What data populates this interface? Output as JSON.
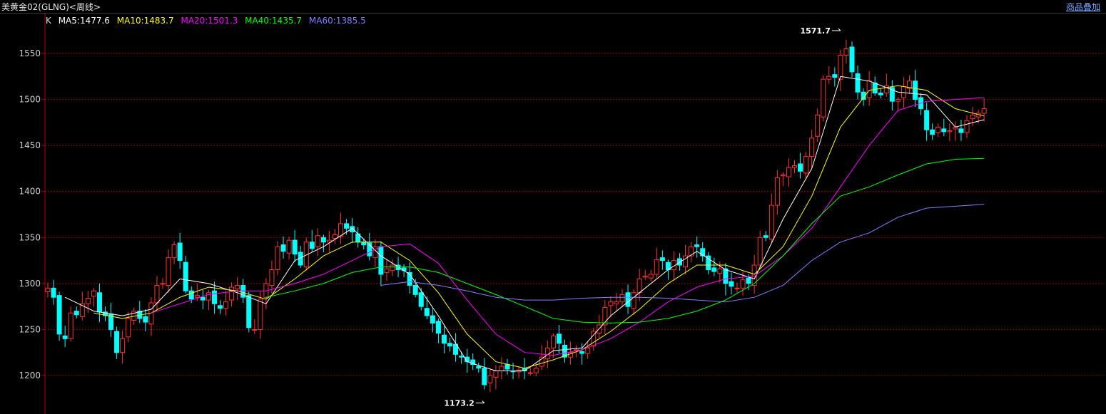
{
  "window": {
    "title": "美黄金02(GLNG)<周线>",
    "overlay_button": "商品叠加"
  },
  "legend": {
    "k_label": "K",
    "items": [
      {
        "text": "MA5:1477.6",
        "color": "#ffffff"
      },
      {
        "text": "MA10:1483.7",
        "color": "#ffff00"
      },
      {
        "text": "MA20:1501.3",
        "color": "#ff00ff"
      },
      {
        "text": "MA40:1435.7",
        "color": "#00ff00"
      },
      {
        "text": "MA60:1385.5",
        "color": "#8080ff"
      }
    ]
  },
  "colors": {
    "up": "#ff3232",
    "down": "#00ffff",
    "grid": "#8b0000",
    "axis_text": "#cccccc",
    "ma5": "#ffffff",
    "ma10": "#ffff00",
    "ma20": "#ff00ff",
    "ma40": "#00ff00",
    "ma60": "#8080ff"
  },
  "chart_data": {
    "type": "candlestick",
    "y_ticks": [
      1200,
      1250,
      1300,
      1350,
      1400,
      1450,
      1500,
      1550
    ],
    "ylim": [
      1173,
      1592
    ],
    "grid": true,
    "annotations": [
      {
        "text": "1571.7",
        "value": 1571.7,
        "index": 138,
        "kind": "high"
      },
      {
        "text": "1173.2",
        "value": 1173.2,
        "index": 76,
        "kind": "low"
      }
    ],
    "closes": [
      1295,
      1285,
      1245,
      1240,
      1268,
      1266,
      1278,
      1284,
      1292,
      1269,
      1265,
      1250,
      1225,
      1240,
      1262,
      1270,
      1262,
      1258,
      1279,
      1298,
      1300,
      1328,
      1342,
      1325,
      1292,
      1283,
      1287,
      1282,
      1290,
      1278,
      1273,
      1280,
      1296,
      1298,
      1285,
      1252,
      1250,
      1283,
      1300,
      1315,
      1340,
      1335,
      1347,
      1332,
      1320,
      1345,
      1338,
      1352,
      1345,
      1347,
      1353,
      1365,
      1360,
      1356,
      1345,
      1342,
      1330,
      1340,
      1310,
      1316,
      1320,
      1315,
      1314,
      1298,
      1288,
      1275,
      1265,
      1257,
      1246,
      1235,
      1232,
      1223,
      1220,
      1215,
      1212,
      1208,
      1190,
      1200,
      1205,
      1210,
      1207,
      1204,
      1206,
      1205,
      1203,
      1208,
      1220,
      1230,
      1243,
      1235,
      1220,
      1225,
      1228,
      1224,
      1230,
      1248,
      1255,
      1274,
      1280,
      1280,
      1288,
      1275,
      1290,
      1305,
      1308,
      1310,
      1326,
      1325,
      1315,
      1325,
      1320,
      1330,
      1340,
      1340,
      1330,
      1315,
      1313,
      1316,
      1300,
      1297,
      1295,
      1304,
      1300,
      1320,
      1350,
      1350,
      1385,
      1415,
      1418,
      1426,
      1428,
      1422,
      1438,
      1458,
      1483,
      1522,
      1525,
      1524,
      1548,
      1555,
      1530,
      1508,
      1500,
      1520,
      1507,
      1505,
      1515,
      1498,
      1500,
      1514,
      1520,
      1500,
      1490,
      1467,
      1462,
      1470,
      1465,
      1466,
      1470,
      1464,
      1477,
      1483,
      1485,
      1490
    ],
    "ma": [
      {
        "name": "MA5",
        "points": [
          [
            3,
            1285
          ],
          [
            8,
            1270
          ],
          [
            13,
            1265
          ],
          [
            18,
            1272
          ],
          [
            23,
            1305
          ],
          [
            28,
            1300
          ],
          [
            33,
            1290
          ],
          [
            38,
            1278
          ],
          [
            43,
            1325
          ],
          [
            48,
            1340
          ],
          [
            53,
            1360
          ],
          [
            58,
            1330
          ],
          [
            63,
            1310
          ],
          [
            68,
            1265
          ],
          [
            73,
            1215
          ],
          [
            78,
            1205
          ],
          [
            83,
            1205
          ],
          [
            88,
            1227
          ],
          [
            93,
            1230
          ],
          [
            98,
            1265
          ],
          [
            103,
            1290
          ],
          [
            108,
            1315
          ],
          [
            113,
            1335
          ],
          [
            118,
            1315
          ],
          [
            123,
            1305
          ],
          [
            128,
            1370
          ],
          [
            133,
            1425
          ],
          [
            138,
            1525
          ],
          [
            143,
            1520
          ],
          [
            148,
            1508
          ],
          [
            153,
            1505
          ],
          [
            158,
            1470
          ],
          [
            163,
            1478
          ]
        ]
      },
      {
        "name": "MA10",
        "points": [
          [
            8,
            1268
          ],
          [
            13,
            1262
          ],
          [
            18,
            1268
          ],
          [
            23,
            1285
          ],
          [
            28,
            1296
          ],
          [
            33,
            1292
          ],
          [
            38,
            1283
          ],
          [
            43,
            1305
          ],
          [
            48,
            1330
          ],
          [
            53,
            1345
          ],
          [
            58,
            1345
          ],
          [
            63,
            1325
          ],
          [
            68,
            1290
          ],
          [
            73,
            1245
          ],
          [
            78,
            1215
          ],
          [
            83,
            1208
          ],
          [
            88,
            1217
          ],
          [
            93,
            1228
          ],
          [
            98,
            1248
          ],
          [
            103,
            1272
          ],
          [
            108,
            1300
          ],
          [
            113,
            1320
          ],
          [
            118,
            1320
          ],
          [
            123,
            1310
          ],
          [
            128,
            1340
          ],
          [
            133,
            1395
          ],
          [
            138,
            1470
          ],
          [
            143,
            1510
          ],
          [
            148,
            1515
          ],
          [
            153,
            1510
          ],
          [
            158,
            1490
          ],
          [
            163,
            1482
          ]
        ]
      },
      {
        "name": "MA20",
        "points": [
          [
            18,
            1268
          ],
          [
            23,
            1278
          ],
          [
            28,
            1288
          ],
          [
            33,
            1292
          ],
          [
            38,
            1292
          ],
          [
            43,
            1300
          ],
          [
            48,
            1310
          ],
          [
            53,
            1325
          ],
          [
            58,
            1340
          ],
          [
            63,
            1343
          ],
          [
            68,
            1322
          ],
          [
            73,
            1282
          ],
          [
            78,
            1245
          ],
          [
            83,
            1225
          ],
          [
            88,
            1222
          ],
          [
            93,
            1228
          ],
          [
            98,
            1240
          ],
          [
            103,
            1258
          ],
          [
            108,
            1280
          ],
          [
            113,
            1296
          ],
          [
            118,
            1305
          ],
          [
            123,
            1308
          ],
          [
            128,
            1330
          ],
          [
            133,
            1360
          ],
          [
            138,
            1405
          ],
          [
            143,
            1450
          ],
          [
            148,
            1488
          ],
          [
            153,
            1498
          ],
          [
            158,
            1500
          ],
          [
            163,
            1502
          ]
        ]
      },
      {
        "name": "MA40",
        "points": [
          [
            38,
            1285
          ],
          [
            43,
            1292
          ],
          [
            48,
            1300
          ],
          [
            53,
            1312
          ],
          [
            58,
            1318
          ],
          [
            63,
            1318
          ],
          [
            68,
            1312
          ],
          [
            73,
            1300
          ],
          [
            78,
            1288
          ],
          [
            83,
            1275
          ],
          [
            88,
            1262
          ],
          [
            93,
            1258
          ],
          [
            98,
            1257
          ],
          [
            103,
            1258
          ],
          [
            108,
            1262
          ],
          [
            113,
            1270
          ],
          [
            118,
            1282
          ],
          [
            123,
            1300
          ],
          [
            128,
            1330
          ],
          [
            133,
            1365
          ],
          [
            138,
            1395
          ],
          [
            143,
            1405
          ],
          [
            148,
            1418
          ],
          [
            153,
            1430
          ],
          [
            158,
            1435
          ],
          [
            163,
            1436
          ]
        ]
      },
      {
        "name": "MA60",
        "points": [
          [
            58,
            1298
          ],
          [
            63,
            1302
          ],
          [
            68,
            1298
          ],
          [
            73,
            1292
          ],
          [
            78,
            1285
          ],
          [
            83,
            1282
          ],
          [
            88,
            1282
          ],
          [
            93,
            1284
          ],
          [
            98,
            1285
          ],
          [
            103,
            1285
          ],
          [
            108,
            1284
          ],
          [
            113,
            1282
          ],
          [
            118,
            1280
          ],
          [
            123,
            1285
          ],
          [
            128,
            1298
          ],
          [
            133,
            1325
          ],
          [
            138,
            1345
          ],
          [
            143,
            1355
          ],
          [
            148,
            1372
          ],
          [
            153,
            1382
          ],
          [
            158,
            1384
          ],
          [
            163,
            1386
          ]
        ]
      }
    ]
  }
}
